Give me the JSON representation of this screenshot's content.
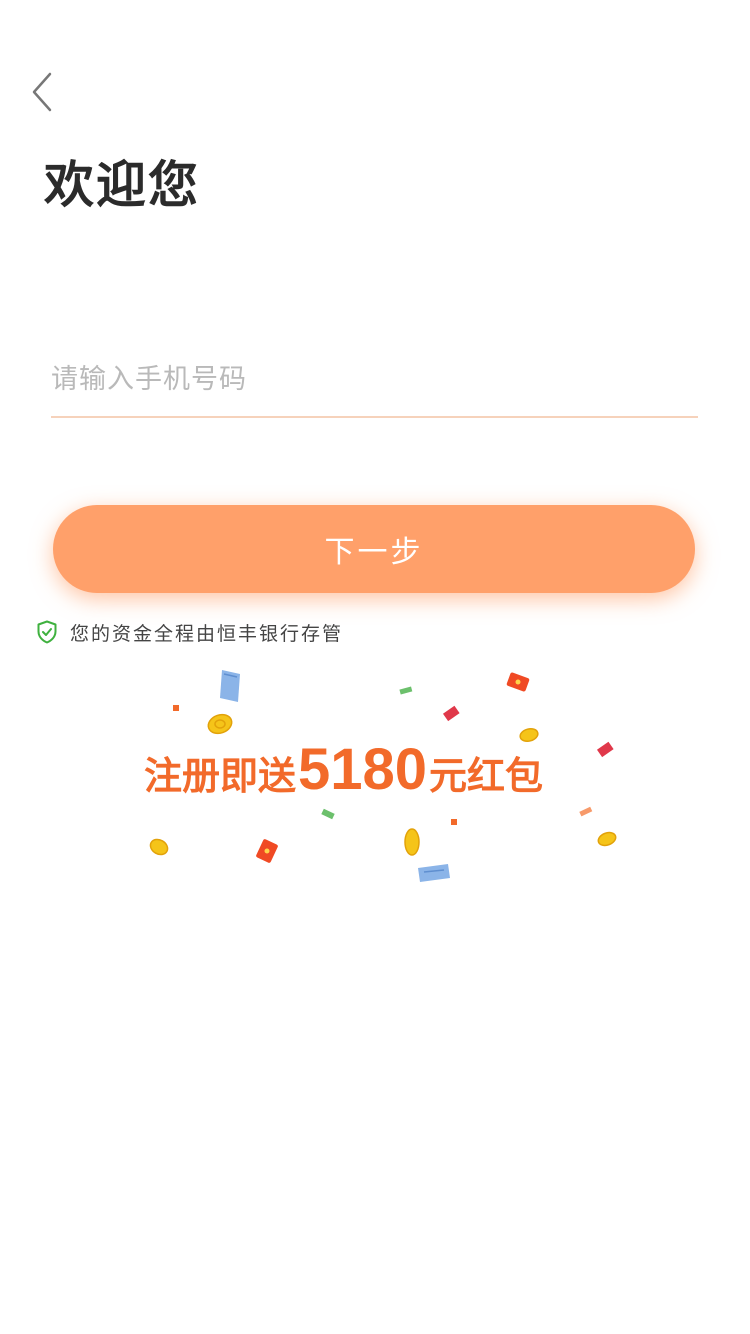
{
  "header": {
    "back_icon": "chevron-left-icon",
    "title": "欢迎您"
  },
  "form": {
    "phone_placeholder": "请输入手机号码",
    "phone_value": "",
    "next_label": "下一步"
  },
  "safety": {
    "icon": "shield-check-icon",
    "text": "您的资金全程由恒丰银行存管"
  },
  "promo": {
    "prefix": "注册即送",
    "amount": "5180",
    "suffix": "元红包",
    "decorations": [
      "coin",
      "red-envelope",
      "banknote"
    ]
  },
  "colors": {
    "accent": "#ffa06a",
    "promo_text": "#f26a2a",
    "shield": "#3fb13f",
    "underline": "#f6d2bb"
  }
}
